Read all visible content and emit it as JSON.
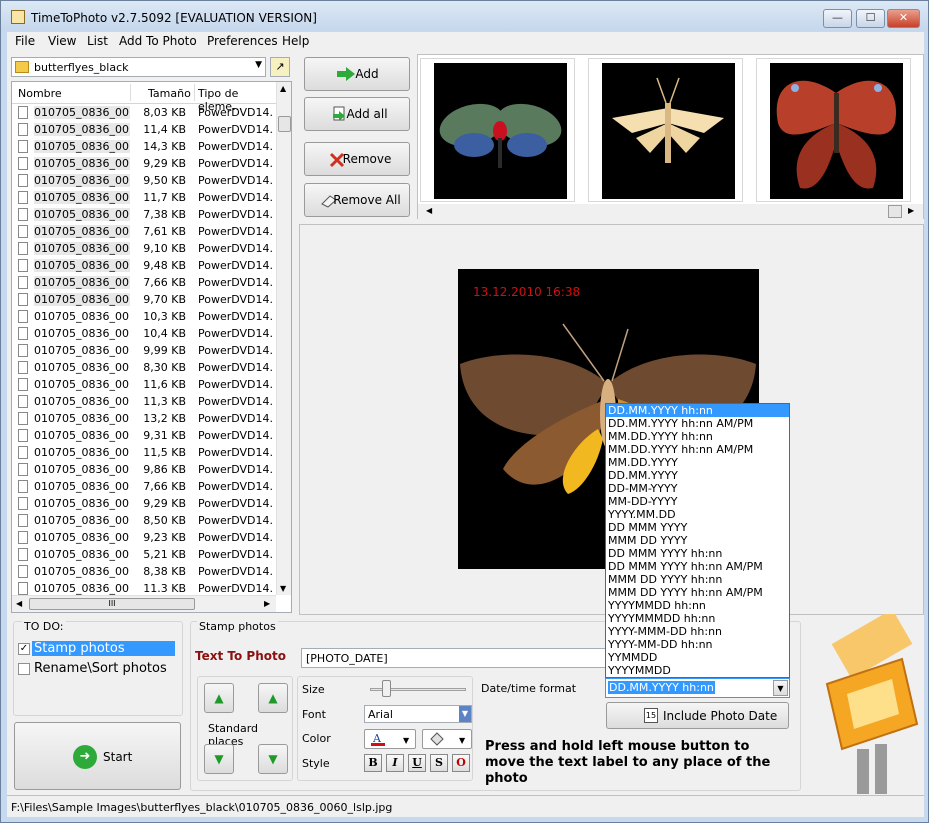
{
  "window": {
    "title": "TimeToPhoto v2.7.5092 [EVALUATION VERSION]",
    "min": "—",
    "max": "☐",
    "close": "✕"
  },
  "menu": [
    {
      "label": "File"
    },
    {
      "label": "View"
    },
    {
      "label": "List"
    },
    {
      "label": "Add To Photo"
    },
    {
      "label": "Preferences"
    },
    {
      "label": "Help"
    }
  ],
  "folder": {
    "name": "butterflyes_black"
  },
  "filelist": {
    "columns": [
      "Nombre",
      "Tamaño",
      "Tipo de eleme..."
    ],
    "rows": [
      {
        "name": "010705_0836_00...",
        "size": "8,03 KB",
        "type": "PowerDVD14..."
      },
      {
        "name": "010705_0836_00...",
        "size": "11,4 KB",
        "type": "PowerDVD14..."
      },
      {
        "name": "010705_0836_00...",
        "size": "14,3 KB",
        "type": "PowerDVD14..."
      },
      {
        "name": "010705_0836_00...",
        "size": "9,29 KB",
        "type": "PowerDVD14..."
      },
      {
        "name": "010705_0836_00...",
        "size": "9,50 KB",
        "type": "PowerDVD14..."
      },
      {
        "name": "010705_0836_00...",
        "size": "11,7 KB",
        "type": "PowerDVD14..."
      },
      {
        "name": "010705_0836_00...",
        "size": "7,38 KB",
        "type": "PowerDVD14..."
      },
      {
        "name": "010705_0836_00...",
        "size": "7,61 KB",
        "type": "PowerDVD14..."
      },
      {
        "name": "010705_0836_00...",
        "size": "9,10 KB",
        "type": "PowerDVD14..."
      },
      {
        "name": "010705_0836_00...",
        "size": "9,48 KB",
        "type": "PowerDVD14..."
      },
      {
        "name": "010705_0836_00...",
        "size": "7,66 KB",
        "type": "PowerDVD14..."
      },
      {
        "name": "010705_0836_00...",
        "size": "9,70 KB",
        "type": "PowerDVD14..."
      },
      {
        "name": "010705_0836_00...",
        "size": "10,3 KB",
        "type": "PowerDVD14..."
      },
      {
        "name": "010705_0836_00...",
        "size": "10,4 KB",
        "type": "PowerDVD14..."
      },
      {
        "name": "010705_0836_00...",
        "size": "9,99 KB",
        "type": "PowerDVD14..."
      },
      {
        "name": "010705_0836_00...",
        "size": "8,30 KB",
        "type": "PowerDVD14..."
      },
      {
        "name": "010705_0836_00...",
        "size": "11,6 KB",
        "type": "PowerDVD14..."
      },
      {
        "name": "010705_0836_00...",
        "size": "11,3 KB",
        "type": "PowerDVD14..."
      },
      {
        "name": "010705_0836_00...",
        "size": "13,2 KB",
        "type": "PowerDVD14..."
      },
      {
        "name": "010705_0836_00...",
        "size": "9,31 KB",
        "type": "PowerDVD14..."
      },
      {
        "name": "010705_0836_00...",
        "size": "11,5 KB",
        "type": "PowerDVD14..."
      },
      {
        "name": "010705_0836_00...",
        "size": "9,86 KB",
        "type": "PowerDVD14..."
      },
      {
        "name": "010705_0836_00...",
        "size": "7,66 KB",
        "type": "PowerDVD14..."
      },
      {
        "name": "010705_0836_00...",
        "size": "9,29 KB",
        "type": "PowerDVD14..."
      },
      {
        "name": "010705_0836_00...",
        "size": "8,50 KB",
        "type": "PowerDVD14..."
      },
      {
        "name": "010705_0836_00...",
        "size": "9,23 KB",
        "type": "PowerDVD14..."
      },
      {
        "name": "010705_0836_00...",
        "size": "5,21 KB",
        "type": "PowerDVD14..."
      },
      {
        "name": "010705_0836_00...",
        "size": "8,38 KB",
        "type": "PowerDVD14..."
      },
      {
        "name": "010705_0836_00...",
        "size": "11.3 KB",
        "type": "PowerDVD14..."
      }
    ],
    "selected_rows": 12,
    "hscroll_thumb": "III"
  },
  "actions": {
    "add": "Add",
    "add_all": "Add all",
    "remove": "Remove",
    "remove_all": "Remove All"
  },
  "preview": {
    "stamp_text": "13.12.2010 16:38"
  },
  "date_formats": [
    "DD.MM.YYYY hh:nn",
    "DD.MM.YYYY hh:nn  AM/PM",
    "MM.DD.YYYY hh:nn",
    "MM.DD.YYYY hh:nn  AM/PM",
    "MM.DD.YYYY",
    "DD.MM.YYYY",
    "DD-MM-YYYY",
    "MM-DD-YYYY",
    "YYYY.MM.DD",
    "DD MMM YYYY",
    "MMM DD YYYY",
    "DD MMM YYYY hh:nn",
    "DD MMM YYYY hh:nn AM/PM",
    "MMM DD YYYY hh:nn",
    "MMM DD YYYY hh:nn  AM/PM",
    "YYYYMMDD hh:nn",
    "YYYYMMMDD hh:nn",
    "YYYY-MMM-DD hh:nn",
    "YYYY-MM-DD hh:nn",
    "YYMMDD",
    "YYYYMMDD"
  ],
  "todo": {
    "title": "TO DO:",
    "stamp_photos": "Stamp photos",
    "rename_sort": "Rename\\Sort photos",
    "stamp_checked": true,
    "rename_checked": false
  },
  "start": {
    "label": "Start"
  },
  "stamp": {
    "title": "Stamp photos",
    "text_to_photo_label": "Text To Photo",
    "text_to_photo_value": "[PHOTO_DATE]",
    "standard_places": "Standard places",
    "size_label": "Size",
    "font_label": "Font",
    "color_label": "Color",
    "style_label": "Style",
    "font_value": "Arial",
    "size_level": 0.15,
    "datetime_label": "Date/time format",
    "datetime_value": "DD.MM.YYYY hh:nn",
    "include_button": "Include Photo Date",
    "hint": "Press and hold left mouse button to move the text label to any place of the photo"
  },
  "status": {
    "path": "F:\\Files\\Sample Images\\butterflyes_black\\010705_0836_0060_lslp.jpg"
  },
  "colors": {
    "accent": "#3399ff",
    "stamp_red": "#d01010",
    "label_red": "#8b1010",
    "arrow_green": "#1f9a2a"
  }
}
